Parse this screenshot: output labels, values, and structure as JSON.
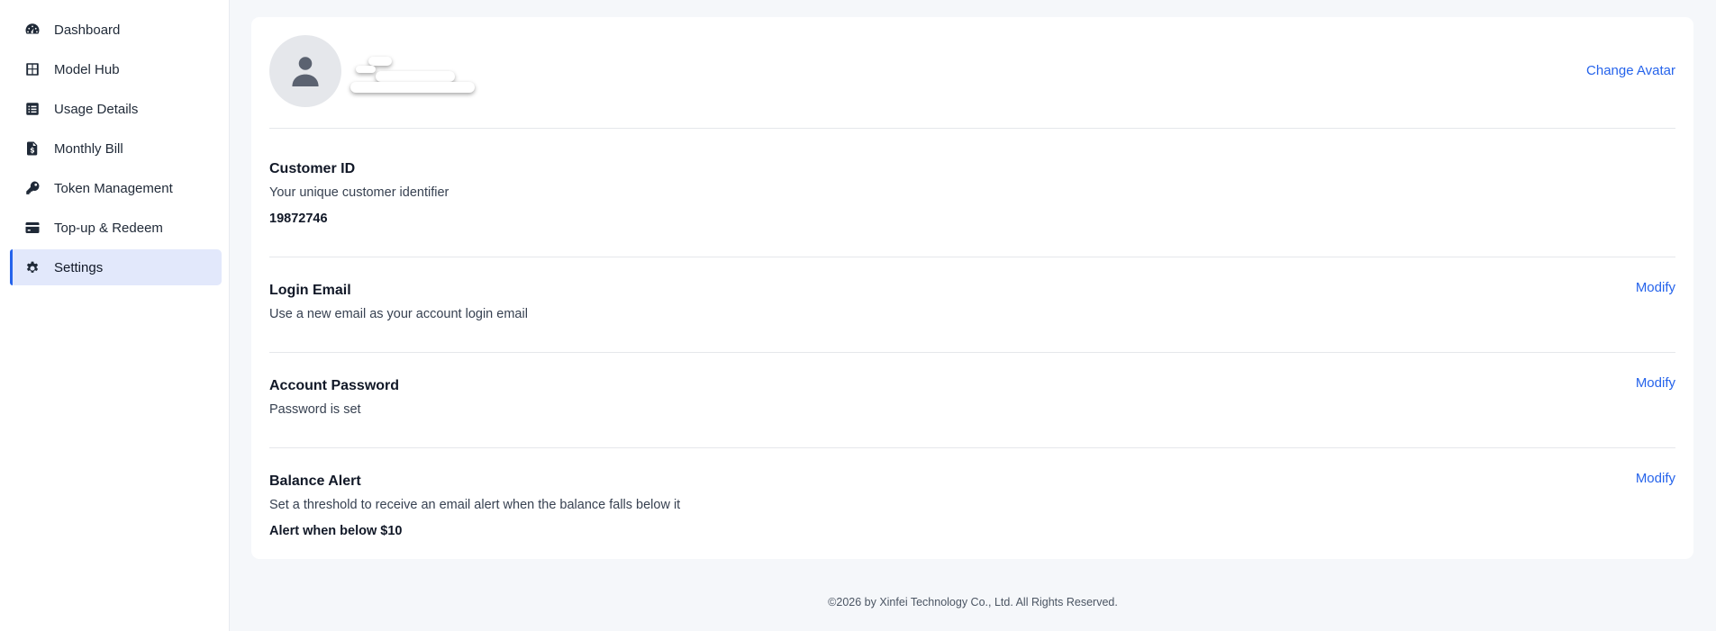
{
  "sidebar": {
    "items": [
      {
        "label": "Dashboard",
        "icon": "dashboard-gauge-icon",
        "active": false
      },
      {
        "label": "Model Hub",
        "icon": "grid-icon",
        "active": false
      },
      {
        "label": "Usage Details",
        "icon": "list-details-icon",
        "active": false
      },
      {
        "label": "Monthly Bill",
        "icon": "invoice-dollar-icon",
        "active": false
      },
      {
        "label": "Token Management",
        "icon": "key-icon",
        "active": false
      },
      {
        "label": "Top-up & Redeem",
        "icon": "credit-card-icon",
        "active": false
      },
      {
        "label": "Settings",
        "icon": "gear-icon",
        "active": true
      }
    ]
  },
  "profile": {
    "avatar_icon": "user-icon",
    "change_avatar_label": "Change Avatar"
  },
  "sections": {
    "customer_id": {
      "title": "Customer ID",
      "description": "Your unique customer identifier",
      "value": "19872746"
    },
    "login_email": {
      "title": "Login Email",
      "description": "Use a new email as your account login email",
      "action": "Modify"
    },
    "account_password": {
      "title": "Account Password",
      "description": "Password is set",
      "action": "Modify"
    },
    "balance_alert": {
      "title": "Balance Alert",
      "description": "Set a threshold to receive an email alert when the balance falls below it",
      "value": "Alert when below $10",
      "action": "Modify"
    }
  },
  "footer": {
    "text": "©2026 by Xinfei Technology Co., Ltd. All Rights Reserved."
  },
  "colors": {
    "accent": "#2563eb",
    "active_nav_bg": "#e2e8fb",
    "page_bg": "#f5f7fa"
  }
}
